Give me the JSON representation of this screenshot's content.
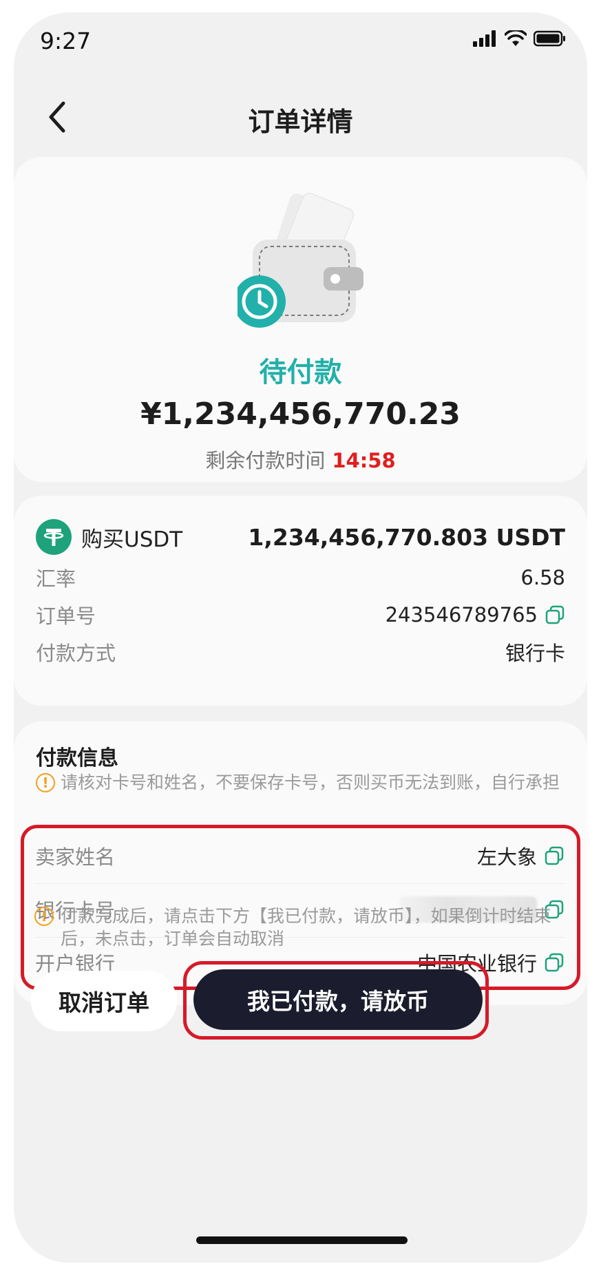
{
  "status_bar": {
    "time": "9:27"
  },
  "header": {
    "title": "订单详情"
  },
  "order_status": {
    "status": "待付款",
    "amount": "¥1,234,456,770.23",
    "remaining_label": "剩余付款时间",
    "countdown": "14:58"
  },
  "order": {
    "buy_label": "购买USDT",
    "buy_amount": "1,234,456,770.803 USDT",
    "rate_label": "汇率",
    "rate_value": "6.58",
    "order_no_label": "订单号",
    "order_no_value": "243546789765",
    "pay_method_label": "付款方式",
    "pay_method_value": "银行卡"
  },
  "payment_info": {
    "title": "付款信息",
    "warning": "请核对卡号和姓名，不要保存卡号，否则买币无法到账，自行承担",
    "seller_label": "卖家姓名",
    "seller_value": "左大象",
    "card_label": "银行卡号",
    "bank_label": "开户银行",
    "bank_value": "中国农业银行"
  },
  "notice": "付款完成后，请点击下方【我已付款，请放币】，如果倒计时结束后，未点击，订单会自动取消",
  "actions": {
    "cancel": "取消订单",
    "confirm": "我已付款，请放币"
  },
  "colors": {
    "accent": "#22b0aa",
    "countdown": "#e01f1f",
    "highlight_border": "#d61a28",
    "primary_button": "#1b1d2e",
    "usdt": "#1ea27b",
    "warning": "#f3a01a"
  }
}
